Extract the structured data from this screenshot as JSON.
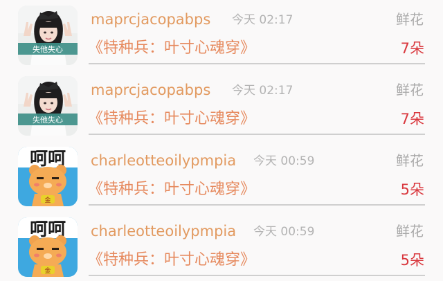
{
  "records": [
    {
      "user": "maprcjacopabps",
      "time": "今天 02:17",
      "gift_label": "鲜花",
      "title": "《特种兵：叶寸心魂穿》",
      "count": "7朵",
      "avatar_icon": "girl-photo-avatar",
      "avatar_caption": "失他失心"
    },
    {
      "user": "maprcjacopabps",
      "time": "今天 02:17",
      "gift_label": "鲜花",
      "title": "《特种兵：叶寸心魂穿》",
      "count": "7朵",
      "avatar_icon": "girl-photo-avatar",
      "avatar_caption": "失他失心"
    },
    {
      "user": "charleotteoilypmpia",
      "time": "今天 00:59",
      "gift_label": "鲜花",
      "title": "《特种兵：叶寸心魂穿》",
      "count": "5朵",
      "avatar_icon": "cartoon-bear-avatar",
      "avatar_caption": "呵呵"
    },
    {
      "user": "charleotteoilypmpia",
      "time": "今天 00:59",
      "gift_label": "鲜花",
      "title": "《特种兵：叶寸心魂穿》",
      "count": "5朵",
      "avatar_icon": "cartoon-bear-avatar",
      "avatar_caption": "呵呵"
    }
  ],
  "colors": {
    "username": "#e29a60",
    "title": "#e6895d",
    "count": "#d9373d",
    "muted": "#b3b3b3",
    "divider": "#cfcfcf"
  }
}
